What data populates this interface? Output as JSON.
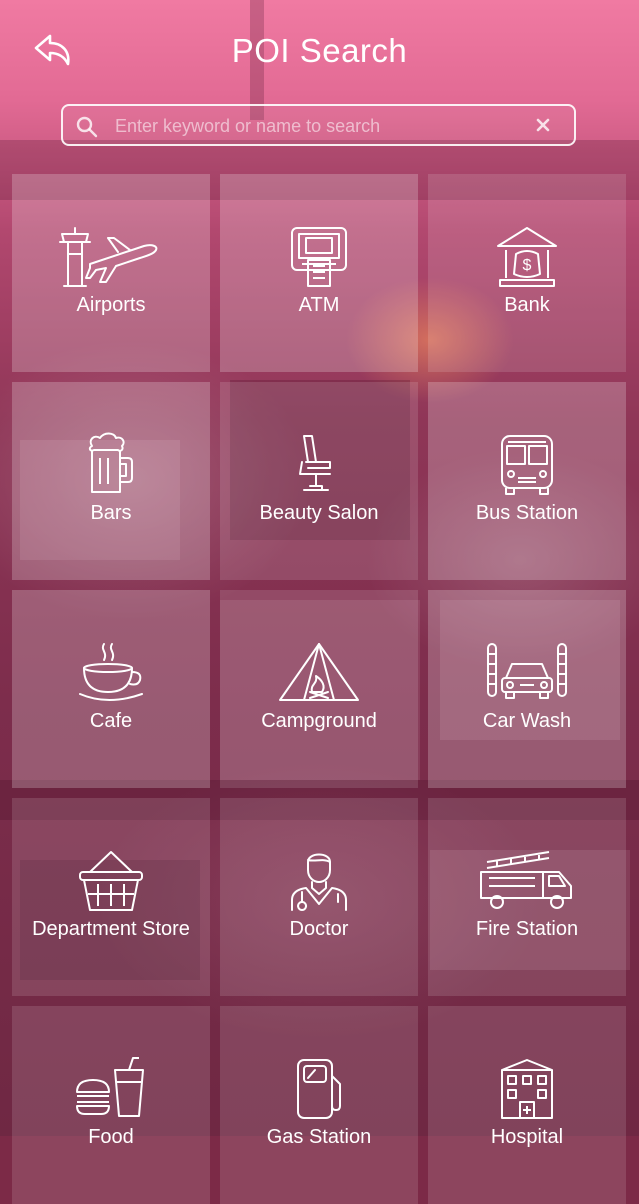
{
  "header": {
    "title": "POI Search",
    "back_icon": "back-arrow-icon"
  },
  "search": {
    "placeholder": "Enter keyword or name to search",
    "value": "",
    "search_icon": "search-icon",
    "clear_icon": "clear-icon"
  },
  "categories": [
    {
      "label": "Airports",
      "icon": "airport-icon"
    },
    {
      "label": "ATM",
      "icon": "atm-icon"
    },
    {
      "label": "Bank",
      "icon": "bank-icon"
    },
    {
      "label": "Bars",
      "icon": "beer-mug-icon"
    },
    {
      "label": "Beauty Salon",
      "icon": "salon-chair-icon"
    },
    {
      "label": "Bus Station",
      "icon": "bus-icon"
    },
    {
      "label": "Cafe",
      "icon": "coffee-cup-icon"
    },
    {
      "label": "Campground",
      "icon": "tent-icon"
    },
    {
      "label": "Car Wash",
      "icon": "car-wash-icon"
    },
    {
      "label": "Department Store",
      "icon": "shopping-basket-icon"
    },
    {
      "label": "Doctor",
      "icon": "doctor-icon"
    },
    {
      "label": "Fire Station",
      "icon": "fire-truck-icon"
    },
    {
      "label": "Food",
      "icon": "burger-drink-icon"
    },
    {
      "label": "Gas Station",
      "icon": "gas-pump-icon"
    },
    {
      "label": "Hospital",
      "icon": "hospital-icon"
    }
  ]
}
